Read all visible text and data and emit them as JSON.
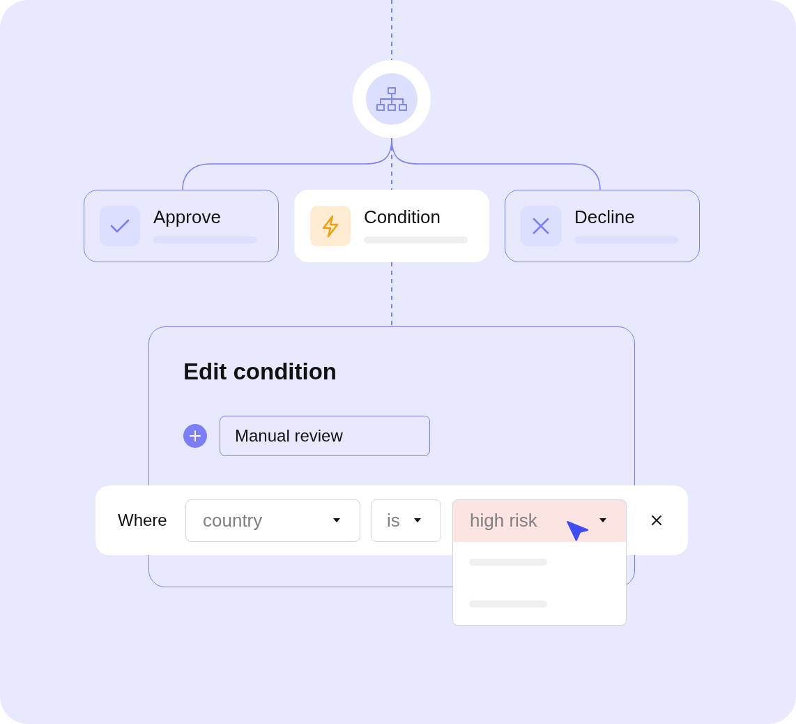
{
  "flow": {
    "branches": [
      {
        "kind": "approve",
        "label": "Approve",
        "selected": false
      },
      {
        "kind": "condition",
        "label": "Condition",
        "selected": true
      },
      {
        "kind": "decline",
        "label": "Decline",
        "selected": false
      }
    ]
  },
  "editor": {
    "title": "Edit condition",
    "name_input": {
      "value": "Manual review"
    }
  },
  "rule": {
    "label": "Where",
    "field_select": {
      "value": "country"
    },
    "operator_select": {
      "value": "is"
    },
    "value_select": {
      "value": "high risk",
      "expanded": true
    }
  }
}
